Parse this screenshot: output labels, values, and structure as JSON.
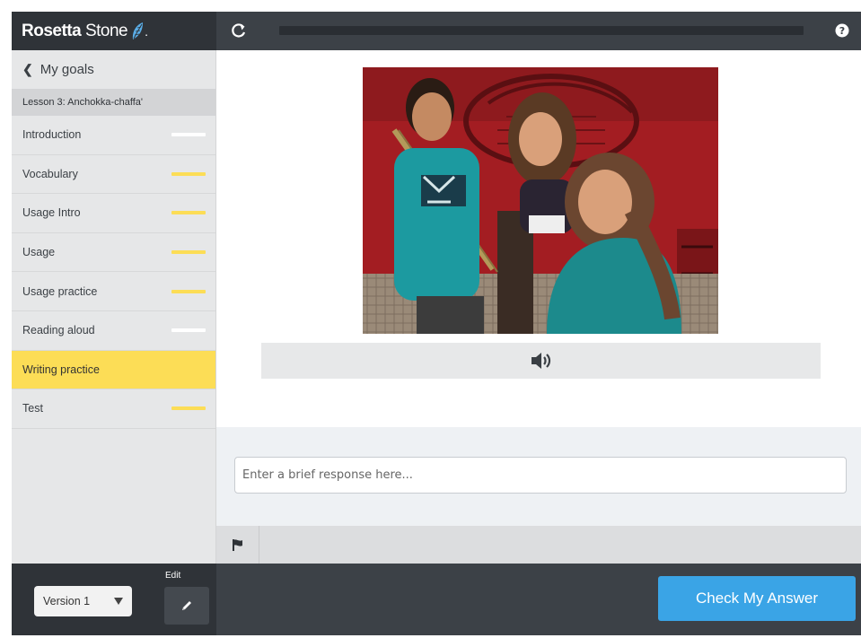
{
  "brand": {
    "name_bold": "Rosetta",
    "name_light": " Stone",
    "dot": "."
  },
  "nav": {
    "back_label": "My goals",
    "lesson_title": "Lesson 3: Anchokka-chaffa'"
  },
  "sidebar": {
    "items": [
      {
        "label": "Introduction",
        "status_color": "#ffffff"
      },
      {
        "label": "Vocabulary",
        "status_color": "#fcdd56"
      },
      {
        "label": "Usage Intro",
        "status_color": "#fcdd56"
      },
      {
        "label": "Usage",
        "status_color": "#fcdd56"
      },
      {
        "label": "Usage practice",
        "status_color": "#fcdd56"
      },
      {
        "label": "Reading aloud",
        "status_color": "#ffffff"
      },
      {
        "label": "Writing practice",
        "status_color": "",
        "active": true
      },
      {
        "label": "Test",
        "status_color": "#fcdd56"
      }
    ]
  },
  "header": {
    "refresh_icon": "refresh-icon",
    "help_icon": "help-icon"
  },
  "exercise": {
    "audio_icon": "speaker-icon",
    "response_placeholder": "Enter a brief response here..."
  },
  "footer": {
    "version_label": "Version 1",
    "edit_label": "Edit",
    "check_label": "Check My Answer"
  },
  "colors": {
    "accent_yellow": "#fcdd56",
    "accent_blue": "#3aa4e6",
    "dark_bar": "#3c4147"
  }
}
